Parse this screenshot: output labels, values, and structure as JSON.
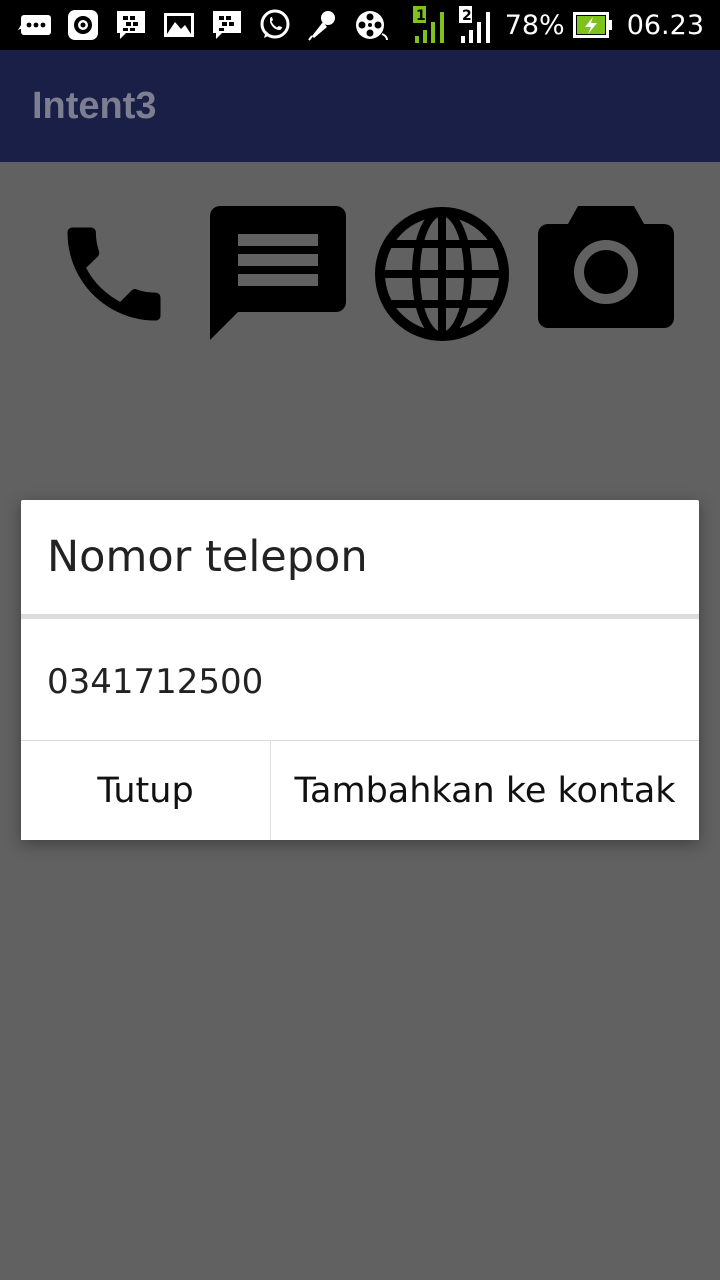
{
  "status_bar": {
    "notification_icons": [
      "message-bubble-icon",
      "camera-lens-icon",
      "bbm-chat-icon",
      "gallery-icon",
      "bbm-icon",
      "whatsapp-icon",
      "microphone-icon",
      "film-reel-icon"
    ],
    "sim1_label": "1",
    "sim2_label": "2",
    "battery_percent": "78%",
    "time": "06.23"
  },
  "app_bar": {
    "title": "Intent3"
  },
  "actions": [
    {
      "name": "phone",
      "icon": "phone-icon"
    },
    {
      "name": "sms",
      "icon": "message-icon"
    },
    {
      "name": "web",
      "icon": "globe-icon"
    },
    {
      "name": "camera",
      "icon": "camera-icon"
    }
  ],
  "dialog": {
    "title": "Nomor telepon",
    "message": "0341712500",
    "negative_button": "Tutup",
    "positive_button": "Tambahkan ke kontak"
  },
  "colors": {
    "scrim": "#616161",
    "app_bar": "#1a1f47",
    "status_bar": "#000000",
    "signal_green": "#7ec21b",
    "dialog_bg": "#ffffff"
  }
}
